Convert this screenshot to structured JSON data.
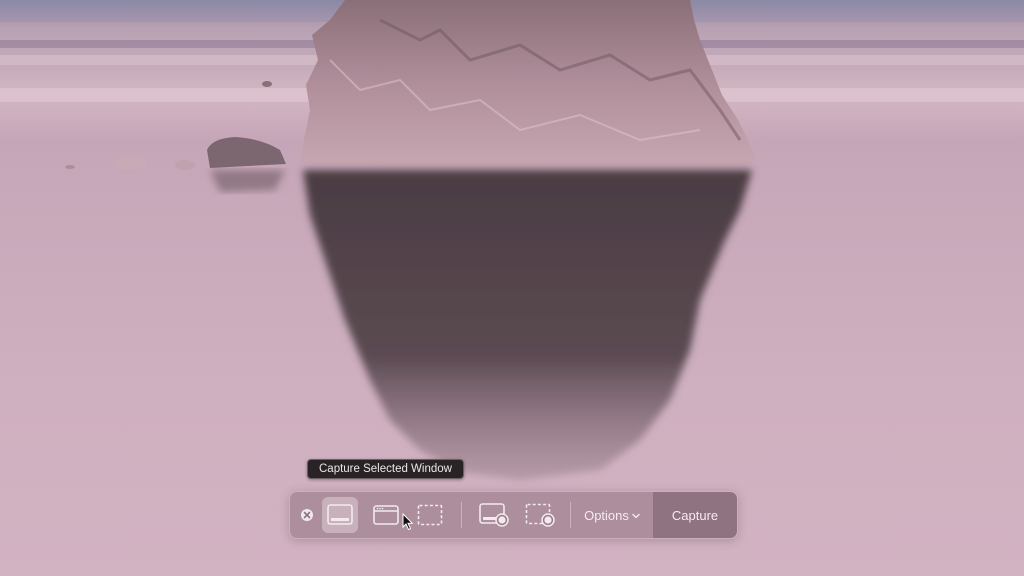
{
  "tooltip": {
    "text": "Capture Selected Window"
  },
  "toolbar": {
    "buttons": [
      {
        "icon": "close-icon",
        "label": "Close"
      },
      {
        "icon": "capture-entire-screen-icon",
        "selected": true
      },
      {
        "icon": "capture-selected-window-icon"
      },
      {
        "icon": "capture-selected-portion-icon"
      },
      {
        "icon": "record-entire-screen-icon"
      },
      {
        "icon": "record-selected-portion-icon"
      }
    ],
    "options_label": "Options",
    "capture_label": "Capture"
  },
  "colors": {
    "toolbar_bg": "#a0808e",
    "tooltip_bg": "#2a2326",
    "icon": "#f2eaee"
  }
}
